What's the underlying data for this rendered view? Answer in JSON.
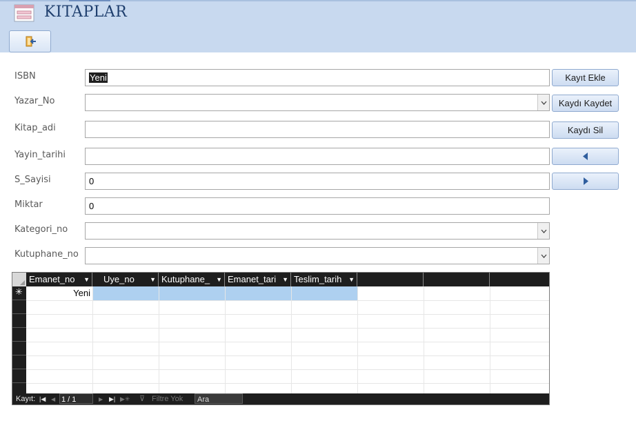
{
  "header": {
    "title": "KITAPLAR",
    "exit_button_icon": "exit-door-icon"
  },
  "fields": [
    {
      "label": "ISBN",
      "value": "Yeni",
      "type": "text"
    },
    {
      "label": "Yazar_No",
      "value": "",
      "type": "combo"
    },
    {
      "label": "Kitap_adi",
      "value": "",
      "type": "text"
    },
    {
      "label": "Yayin_tarihi",
      "value": "",
      "type": "text"
    },
    {
      "label": "S_Sayisi",
      "value": "0",
      "type": "text"
    },
    {
      "label": "Miktar",
      "value": "0",
      "type": "text"
    },
    {
      "label": "Kategori_no",
      "value": "",
      "type": "combo"
    },
    {
      "label": "Kutuphane_no",
      "value": "",
      "type": "combo"
    }
  ],
  "buttons": {
    "add": "Kayıt Ekle",
    "save": "Kaydı Kaydet",
    "delete": "Kaydı Sil",
    "prev_icon": "triangle-left-icon",
    "next_icon": "triangle-right-icon"
  },
  "subform": {
    "columns": [
      "Emanet_no",
      "Uye_no",
      "Kutuphane_",
      "Emanet_tari",
      "Teslim_tarih"
    ],
    "new_row_marker": "✳",
    "new_row_value": "Yeni",
    "navigation": {
      "record_label": "Kayıt:",
      "position": "1 / 1",
      "filter": "Filtre Yok",
      "search": "Ara"
    }
  },
  "colors": {
    "header_bg": "#c8d9ef",
    "title": "#1f3f6e",
    "datasheet_header": "#1e1e1e",
    "new_row_highlight": "#aed0f0"
  }
}
